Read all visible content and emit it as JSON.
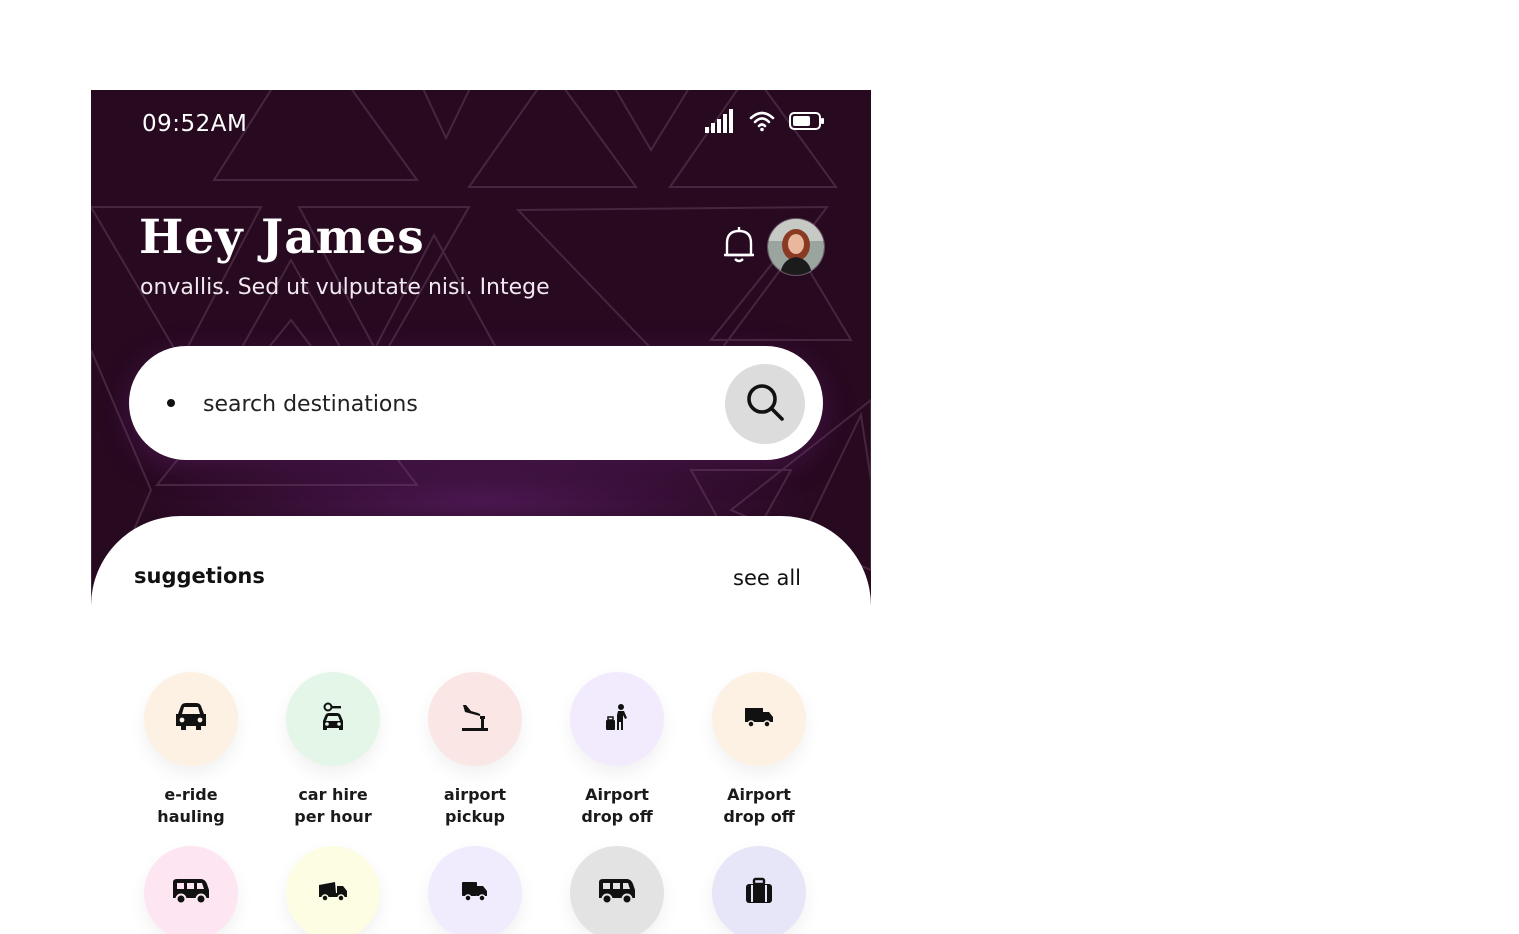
{
  "status_bar": {
    "time": "09:52AM"
  },
  "header": {
    "greeting": "Hey James",
    "subtitle": "onvallis. Sed ut vulputate nisi. Intege"
  },
  "search": {
    "placeholder": "search destinations"
  },
  "suggestions": {
    "title": "suggetions",
    "see_all": "see all",
    "services": [
      {
        "line1": "e-ride",
        "line2": "hauling",
        "icon": "car-icon",
        "color": "#fdf1e4"
      },
      {
        "line1": "car hire",
        "line2": "per hour",
        "icon": "car-key-icon",
        "color": "#e4f6e8"
      },
      {
        "line1": "airport",
        "line2": "pickup",
        "icon": "airplane-landing-icon",
        "color": "#fbe6e6"
      },
      {
        "line1": "Airport",
        "line2": "drop off",
        "icon": "traveler-luggage-icon",
        "color": "#f2ebfd"
      },
      {
        "line1": "Airport",
        "line2": "drop off",
        "icon": "delivery-truck-icon",
        "color": "#fdf1e4"
      },
      {
        "line1": "",
        "line2": "",
        "icon": "van-icon",
        "color": "#fde6f2"
      },
      {
        "line1": "",
        "line2": "",
        "icon": "dump-truck-icon",
        "color": "#fdfde4"
      },
      {
        "line1": "",
        "line2": "",
        "icon": "truck-icon",
        "color": "#f0ecfd"
      },
      {
        "line1": "",
        "line2": "",
        "icon": "bus-icon",
        "color": "#e3e3e3"
      },
      {
        "line1": "",
        "line2": "",
        "icon": "suitcase-icon",
        "color": "#e6e6f8"
      }
    ]
  }
}
